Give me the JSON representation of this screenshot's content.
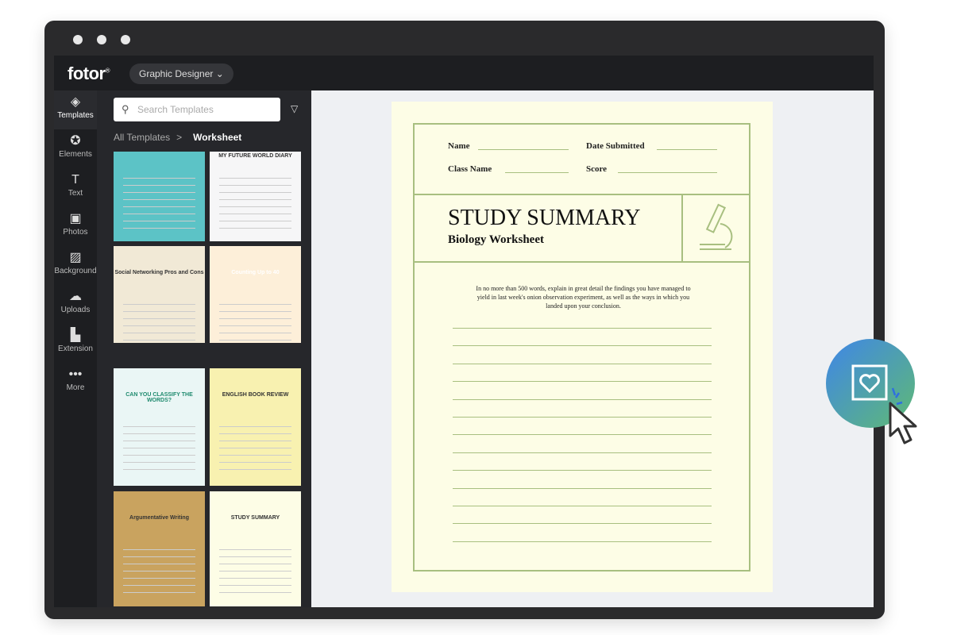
{
  "window": {
    "dots": 3
  },
  "topbar": {
    "logo": "fotor",
    "mode_label": "Graphic Designer"
  },
  "rail": [
    {
      "label": "Templates",
      "icon": "layers-icon"
    },
    {
      "label": "Elements",
      "icon": "star-icon"
    },
    {
      "label": "Text",
      "icon": "text-icon"
    },
    {
      "label": "Photos",
      "icon": "photo-icon"
    },
    {
      "label": "Background",
      "icon": "background-icon"
    },
    {
      "label": "Uploads",
      "icon": "cloud-upload-icon"
    },
    {
      "label": "Extension",
      "icon": "extension-icon"
    },
    {
      "label": "More",
      "icon": "more-icon"
    }
  ],
  "panel": {
    "search_placeholder": "Search Templates",
    "breadcrumb": {
      "root": "All Templates",
      "current": "Worksheet"
    },
    "thumbnails": [
      {
        "title": "",
        "bg": "#5cc3c6"
      },
      {
        "title": "MY FUTURE WORLD DIARY",
        "bg": "#f6f6f7"
      },
      {
        "title": "Social Networking Pros and Cons",
        "bg": "#f1e9d6"
      },
      {
        "title": "Counting Up to 40",
        "bg": "#fdefd9"
      },
      {
        "title": "CAN YOU CLASSIFY THE WORDS?",
        "bg": "#eaf6f5"
      },
      {
        "title": "ENGLISH BOOK REVIEW",
        "bg": "#f8f1b0"
      },
      {
        "title": "Argumentative Writing",
        "bg": "#c9a35f"
      },
      {
        "title": "STUDY SUMMARY",
        "bg": "#fdfde6"
      }
    ]
  },
  "document": {
    "fields": {
      "name": "Name",
      "date": "Date Submitted",
      "class": "Class Name",
      "score": "Score"
    },
    "title": "STUDY SUMMARY",
    "subtitle": "Biology Worksheet",
    "instructions": "In no more than 500 words, explain in great detail the findings you have managed to yield in last week's onion observation experiment, as well as the ways in which you landed upon your conclusion.",
    "accent": "#a8bf80",
    "paper": "#fdfde6"
  },
  "fab": {
    "icon": "favorite-frame-icon"
  }
}
